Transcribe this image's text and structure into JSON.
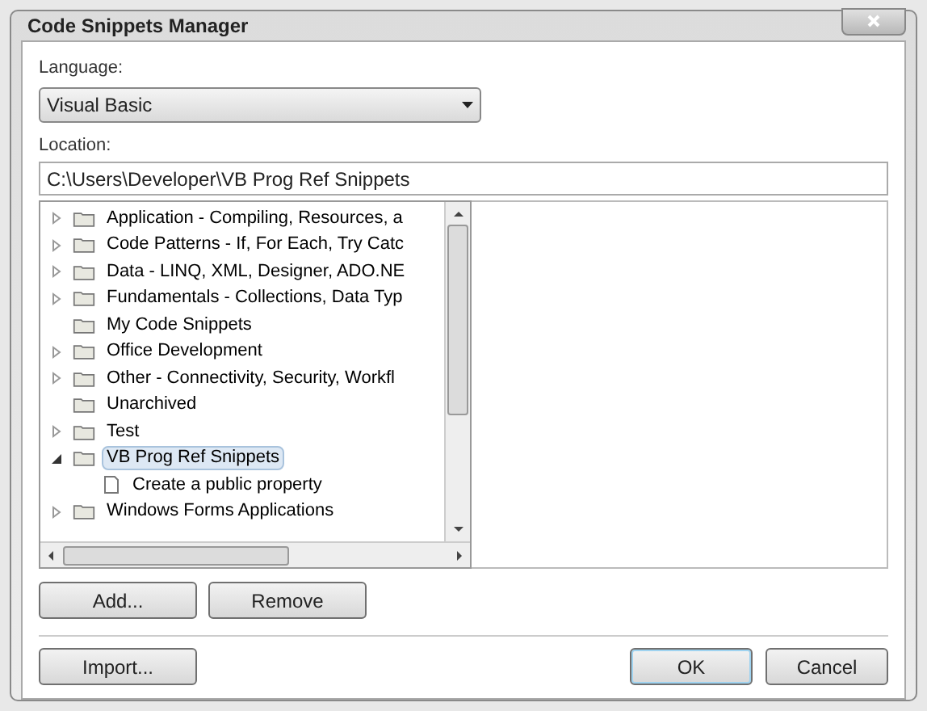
{
  "window": {
    "title": "Code Snippets Manager"
  },
  "language": {
    "label": "Language:",
    "value": "Visual Basic"
  },
  "location": {
    "label": "Location:",
    "value": "C:\\Users\\Developer\\VB Prog Ref Snippets"
  },
  "tree": [
    {
      "label": "Application - Compiling, Resources, a",
      "expanded": false,
      "selected": false
    },
    {
      "label": "Code Patterns - If, For Each, Try Catc",
      "expanded": false,
      "selected": false
    },
    {
      "label": "Data - LINQ, XML, Designer, ADO.NE",
      "expanded": false,
      "selected": false
    },
    {
      "label": "Fundamentals - Collections, Data Typ",
      "expanded": false,
      "selected": false
    },
    {
      "label": "My Code Snippets",
      "selected": false
    },
    {
      "label": "Office Development",
      "expanded": false,
      "selected": false
    },
    {
      "label": "Other - Connectivity, Security, Workfl",
      "expanded": false,
      "selected": false
    },
    {
      "label": "Unarchived",
      "selected": false
    },
    {
      "label": "Test",
      "expanded": false,
      "selected": false
    },
    {
      "label": "VB Prog Ref Snippets",
      "expanded": true,
      "selected": true,
      "children": [
        {
          "label": "Create a public property",
          "selected": false
        }
      ]
    },
    {
      "label": "Windows Forms Applications",
      "expanded": false,
      "selected": false
    }
  ],
  "tree_buttons": [
    "Add...",
    "Remove"
  ],
  "import_button": "Import...",
  "dialog_buttons": [
    "OK",
    "Cancel"
  ]
}
